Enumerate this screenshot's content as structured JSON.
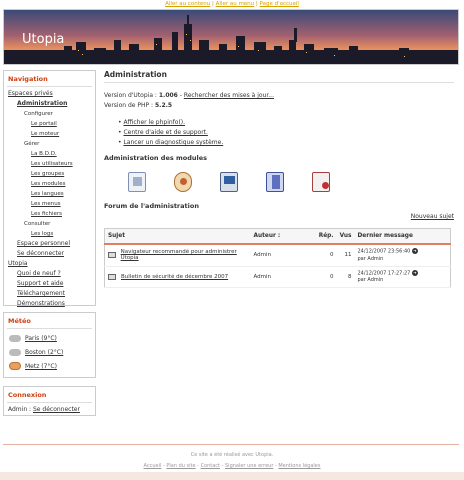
{
  "skip": {
    "content": "Aller au contenu",
    "menu": "Aller au menu",
    "top": "Page d'accueil",
    "sep": " | "
  },
  "site": {
    "title": "Utopia"
  },
  "nav": {
    "title": "Navigation",
    "espaces": "Espaces privés",
    "admin": "Administration",
    "configurer": "Configurer",
    "portail": "Le portail",
    "moteur": "Le moteur",
    "gerer": "Gérer",
    "bdd": "La B.D.D.",
    "utilisateurs": "Les utilisateurs",
    "groupes": "Les groupes",
    "modules": "Les modules",
    "langues": "Les langues",
    "menus": "Les menus",
    "fichiers": "Les fichiers",
    "consulter": "Consulter",
    "logs": "Les logs",
    "espace_perso": "Espace personnel",
    "deconnecter": "Se déconnecter",
    "utopia": "Utopia",
    "quoi": "Quoi de neuf ?",
    "support": "Support et aide",
    "telechargement": "Téléchargement",
    "demos": "Démonstrations"
  },
  "meteo": {
    "title": "Météo",
    "cities": [
      "Paris (9°C)",
      "Boston (2°C)",
      "Metz (7°C)"
    ]
  },
  "connexion": {
    "title": "Connexion",
    "user": "Admin :",
    "logout": "Se déconnecter"
  },
  "main": {
    "title": "Administration",
    "version_label": "Version d'Utopia :",
    "version": "1.006",
    "update_link": "Rechercher des mises à jour...",
    "php_label": "Version de PHP :",
    "php": "5.2.5",
    "links": [
      "Afficher le phpinfo().",
      "Centre d'aide et de support.",
      "Lancer un diagnostique système."
    ],
    "modules_title": "Administration des modules",
    "forum_title": "Forum de l'administration",
    "new_subject": "Nouveau sujet"
  },
  "table": {
    "headers": [
      "Sujet",
      "Auteur :",
      "Rép.",
      "Vus",
      "Dernier message"
    ],
    "rows": [
      {
        "subject": "Navigateur recommandé pour administrer Utopia",
        "author": "Admin",
        "replies": "0",
        "views": "11",
        "date": "24/12/2007 23:56:40",
        "by": "par Admin"
      },
      {
        "subject": "Bulletin de sécurité de décembre 2007",
        "author": "Admin",
        "replies": "0",
        "views": "8",
        "date": "24/12/2007 17:27:27",
        "by": "par Admin"
      }
    ]
  },
  "footer": {
    "line1": "Ce site a été réalisé avec Utopia.",
    "links": [
      "Accueil",
      "Plan du site",
      "Contact",
      "Signaler une erreur",
      "Mentions légales"
    ],
    "sep": " - "
  }
}
